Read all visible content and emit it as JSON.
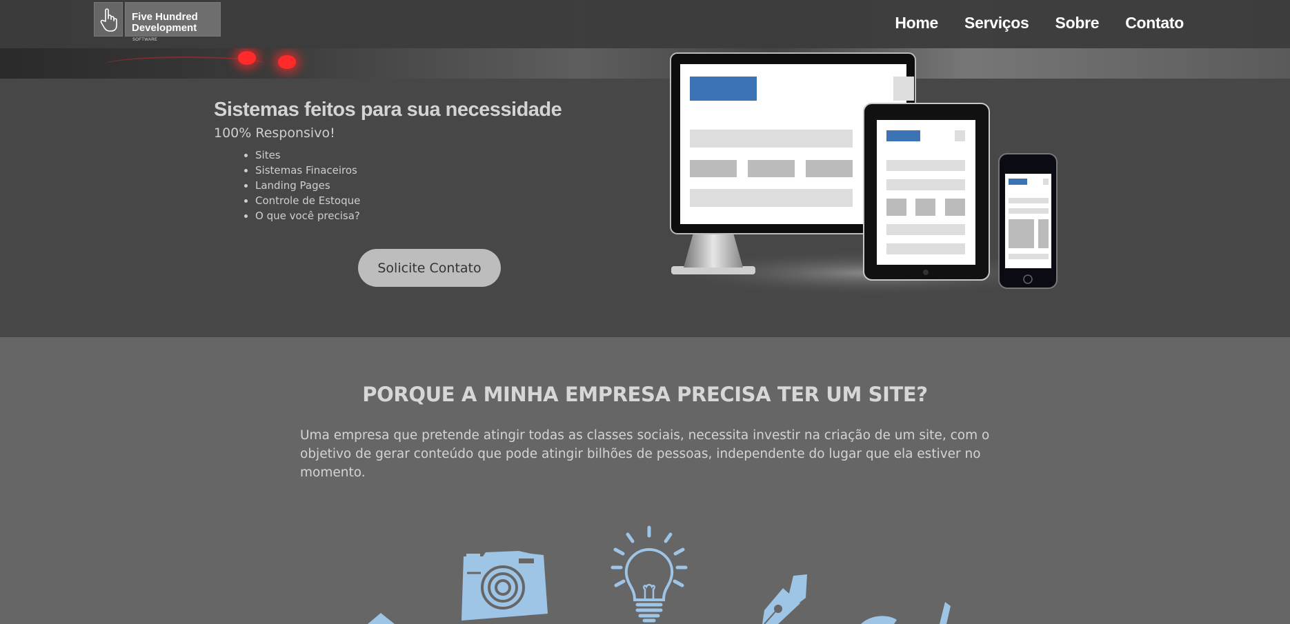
{
  "brand": {
    "name_line1": "Five Hundred",
    "name_line2": "Development",
    "tagline": "SOFTWARE",
    "logo_icon": "pointer-hand-icon"
  },
  "nav": {
    "items": [
      {
        "label": "Home"
      },
      {
        "label": "Serviços"
      },
      {
        "label": "Sobre"
      },
      {
        "label": "Contato"
      }
    ]
  },
  "hero": {
    "title": "Sistemas feitos para sua necessidade",
    "subtitle": "100% Responsivo!",
    "list": [
      "Sites",
      "Sistemas Finaceiros",
      "Landing Pages",
      "Controle de Estoque",
      "O que você precisa?"
    ],
    "cta_label": "Solicite Contato",
    "illustration": "responsive-devices-illustration"
  },
  "why": {
    "title": "PORQUE A MINHA EMPRESA PRECISA TER UM SITE?",
    "text": "Uma empresa que pretende atingir todas as classes sociais, necessita investir na criação de um site, com o objetivo de gerar conteúdo que pode atingir bilhões de pessoas, independente do lugar que ela estiver no momento.",
    "icons": [
      "pencil-icon",
      "camera-icon",
      "lightbulb-icon",
      "pen-nib-icon",
      "pen-tool-icon"
    ]
  },
  "colors": {
    "navbar": "#3c3c3c",
    "hero_bg": "#474747",
    "section_bg": "#666666",
    "accent_blue": "#3b73b4",
    "icon_blue": "#9ec4e6",
    "cta_bg": "#bdbdbd"
  }
}
